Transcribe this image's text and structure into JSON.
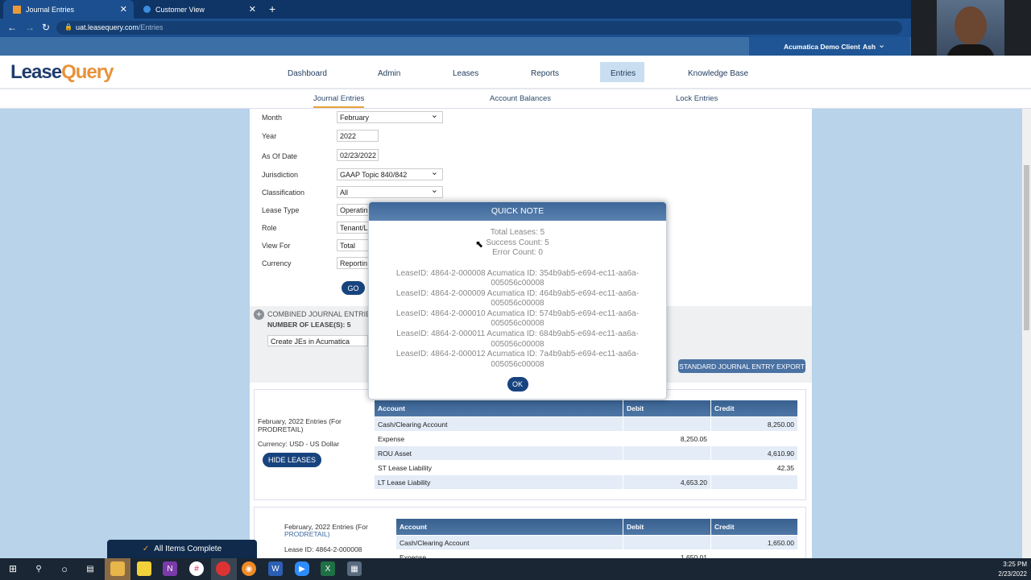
{
  "browser": {
    "tabs": [
      {
        "label": "Journal Entries"
      },
      {
        "label": "Customer View"
      }
    ],
    "url_host": "uat.leasequery.com",
    "url_path": "/Entries"
  },
  "app": {
    "logo": "LeaseQuery",
    "client": "Acumatica Demo Client",
    "user": "Ash",
    "nav": [
      "Dashboard",
      "Admin",
      "Leases",
      "Reports",
      "Entries",
      "Knowledge Base"
    ],
    "active_nav": "Entries",
    "subnav": [
      "Journal Entries",
      "Account Balances",
      "Lock Entries"
    ]
  },
  "form": {
    "month": {
      "label": "Month",
      "value": "February"
    },
    "year": {
      "label": "Year",
      "value": "2022"
    },
    "as_of": {
      "label": "As Of Date",
      "value": "02/23/2022"
    },
    "jurisdiction": {
      "label": "Jurisdiction",
      "value": "GAAP Topic 840/842"
    },
    "classification": {
      "label": "Classification",
      "value": "All"
    },
    "lease_type": {
      "label": "Lease Type",
      "value": "Operatin"
    },
    "role": {
      "label": "Role",
      "value": "Tenant/L"
    },
    "view_for": {
      "label": "View For",
      "value": "Total"
    },
    "currency": {
      "label": "Currency",
      "value": "Reportin"
    },
    "go": "GO"
  },
  "combined": {
    "title": "COMBINED JOURNAL ENTRIE",
    "count": "NUMBER OF LEASE(S): 5",
    "action": "Create JEs in Acumatica",
    "export": "STANDARD JOURNAL ENTRY EXPORT"
  },
  "modal": {
    "title": "QUICK NOTE",
    "total": "Total Leases: 5",
    "success": "Success Count: 5",
    "error": "Error Count: 0",
    "lines": [
      {
        "a": "LeaseID: 4864-2-000008 Acumatica ID: 354b9ab5-e694-ec11-aa6a-",
        "b": "005056c00008"
      },
      {
        "a": "LeaseID: 4864-2-000009 Acumatica ID: 464b9ab5-e694-ec11-aa6a-",
        "b": "005056c00008"
      },
      {
        "a": "LeaseID: 4864-2-000010 Acumatica ID: 574b9ab5-e694-ec11-aa6a-",
        "b": "005056c00008"
      },
      {
        "a": "LeaseID: 4864-2-000011 Acumatica ID: 684b9ab5-e694-ec11-aa6a-",
        "b": "005056c00008"
      },
      {
        "a": "LeaseID: 4864-2-000012 Acumatica ID: 7a4b9ab5-e694-ec11-aa6a-",
        "b": "005056c00008"
      }
    ],
    "ok": "OK"
  },
  "entries1": {
    "title": "February, 2022 Entries (For PRODRETAIL)",
    "currency": "Currency: USD - US Dollar",
    "hide": "HIDE LEASES",
    "headers": [
      "Account",
      "Debit",
      "Credit"
    ],
    "rows": [
      [
        "Cash/Clearing Account",
        "",
        "8,250.00"
      ],
      [
        "Expense",
        "8,250.05",
        ""
      ],
      [
        "ROU Asset",
        "",
        "4,610.90"
      ],
      [
        "ST Lease Liability",
        "",
        "42.35"
      ],
      [
        "LT Lease Liability",
        "4,653.20",
        ""
      ]
    ]
  },
  "entries2": {
    "title": "February, 2022 Entries (For",
    "title2": "PRODRETAIL)",
    "lease_id": "Lease ID: 4864-2-000008",
    "headers": [
      "Account",
      "Debit",
      "Credit"
    ],
    "rows": [
      [
        "Cash/Clearing Account",
        "",
        "1,650.00"
      ],
      [
        "Expense",
        "1,650.01",
        ""
      ]
    ]
  },
  "toast": "All Items Complete",
  "clock": {
    "time": "3:25 PM",
    "date": "2/23/2022"
  }
}
